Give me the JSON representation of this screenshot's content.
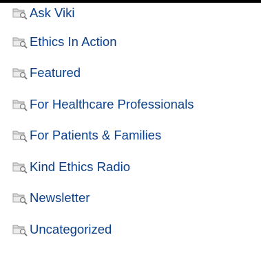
{
  "categories": [
    {
      "label": "Ask Viki",
      "icon": "folder-search-icon"
    },
    {
      "label": "Ethics In Action",
      "icon": "folder-search-icon"
    },
    {
      "label": "Featured",
      "icon": "folder-search-icon"
    },
    {
      "label": "For Healthcare Professionals",
      "icon": "folder-search-icon"
    },
    {
      "label": "For Patients & Families",
      "icon": "folder-search-icon"
    },
    {
      "label": "Kind Ethics Radio",
      "icon": "folder-search-icon"
    },
    {
      "label": "Newsletter",
      "icon": "folder-search-icon"
    },
    {
      "label": "Uncategorized",
      "icon": "folder-search-icon"
    }
  ],
  "colors": {
    "link": "#0a3f8a",
    "icon_folder": "#d6d6d6",
    "icon_outline": "#9a9a9a"
  }
}
